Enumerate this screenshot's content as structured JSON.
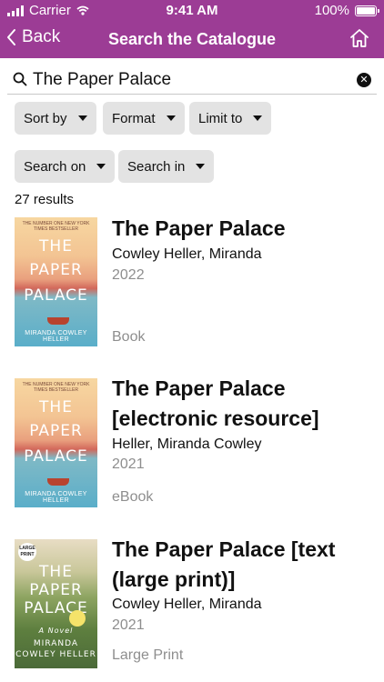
{
  "status": {
    "carrier": "Carrier",
    "time": "9:41 AM",
    "battery": "100%"
  },
  "nav": {
    "back_label": "Back",
    "title": "Search the Catalogue"
  },
  "search": {
    "value": "The Paper Palace"
  },
  "filters": {
    "sort_by": "Sort by",
    "format": "Format",
    "limit_to": "Limit to",
    "search_on": "Search on",
    "search_in": "Search in"
  },
  "results_count": "27 results",
  "results": [
    {
      "title": "The Paper Palace",
      "author": "Cowley Heller, Miranda",
      "year": "2022",
      "format": "Book",
      "cover": {
        "blurb": "THE NUMBER ONE NEW YORK TIMES BESTSELLER",
        "line1": "THE",
        "line2": "PAPER",
        "line3": "PALACE",
        "author": "MIRANDA COWLEY HELLER"
      }
    },
    {
      "title": "The Paper Palace [electronic resource]",
      "author": "Heller, Miranda Cowley",
      "year": "2021",
      "format": "eBook",
      "cover": {
        "blurb": "THE NUMBER ONE NEW YORK TIMES BESTSELLER",
        "line1": "THE",
        "line2": "PAPER",
        "line3": "PALACE",
        "author": "MIRANDA COWLEY HELLER"
      }
    },
    {
      "title": "The Paper Palace [text (large print)]",
      "author": "Cowley Heller, Miranda",
      "year": "2021",
      "format": "Large Print",
      "cover": {
        "badge": "LARGE PRINT",
        "line1": "THE",
        "line2": "PAPER",
        "line3": "PALACE",
        "subtitle": "A Novel",
        "author1": "MIRANDA",
        "author2": "COWLEY HELLER"
      }
    }
  ]
}
